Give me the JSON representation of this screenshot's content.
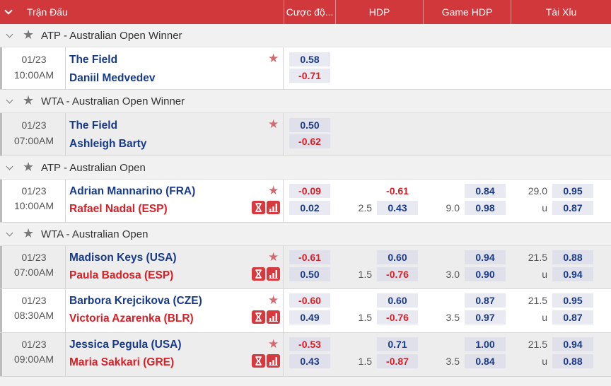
{
  "header": {
    "match_label": "Trận Đấu",
    "odds_label": "Cược độ...",
    "hdp_label": "HDP",
    "game_hdp_label": "Game HDP",
    "taixiu_label": "Tài Xỉu"
  },
  "colors": {
    "header_bg": "#d0383c",
    "team_blue": "#183a8a",
    "team_red": "#d91f26",
    "odds_red": "#d91f26"
  },
  "sections": [
    {
      "league": "ATP - Australian Open Winner",
      "matches": [
        {
          "date": "01/23",
          "time": "10:00AM",
          "home": {
            "name": "The Field",
            "color": "blue"
          },
          "away": {
            "name": "Daniil Medvedev",
            "color": "blue"
          },
          "icons": false,
          "odds": [
            "0.58",
            "-0.71"
          ]
        }
      ]
    },
    {
      "league": "WTA - Australian Open Winner",
      "matches": [
        {
          "date": "01/23",
          "time": "07:00AM",
          "home": {
            "name": "The Field",
            "color": "blue"
          },
          "away": {
            "name": "Ashleigh Barty",
            "color": "blue"
          },
          "icons": false,
          "odds": [
            "0.50",
            "-0.62"
          ]
        }
      ]
    },
    {
      "league": "ATP - Australian Open",
      "matches": [
        {
          "date": "01/23",
          "time": "10:00AM",
          "home": {
            "name": "Adrian Mannarino (FRA)",
            "color": "blue"
          },
          "away": {
            "name": "Rafael Nadal (ESP)",
            "color": "red"
          },
          "icons": true,
          "odds": [
            "-0.09",
            "0.02"
          ],
          "hdp": {
            "line": "2.5",
            "top": "-0.61",
            "bot": "0.43",
            "top_box": false
          },
          "game_hdp": {
            "line": "9.0",
            "top": "0.84",
            "bot": "0.98"
          },
          "taixiu": {
            "line": "29.0",
            "u": "u",
            "top": "0.95",
            "bot": "0.87"
          }
        }
      ]
    },
    {
      "league": "WTA - Australian Open",
      "matches": [
        {
          "date": "01/23",
          "time": "07:00AM",
          "home": {
            "name": "Madison Keys (USA)",
            "color": "blue"
          },
          "away": {
            "name": "Paula Badosa (ESP)",
            "color": "red"
          },
          "icons": true,
          "odds": [
            "-0.61",
            "0.50"
          ],
          "hdp": {
            "line": "1.5",
            "top": "0.60",
            "bot": "-0.76",
            "top_box": true
          },
          "game_hdp": {
            "line": "3.0",
            "top": "0.94",
            "bot": "0.90"
          },
          "taixiu": {
            "line": "21.5",
            "u": "u",
            "top": "0.88",
            "bot": "0.94"
          }
        },
        {
          "date": "01/23",
          "time": "08:30AM",
          "home": {
            "name": "Barbora Krejcikova (CZE)",
            "color": "blue"
          },
          "away": {
            "name": "Victoria Azarenka (BLR)",
            "color": "red"
          },
          "icons": true,
          "odds": [
            "-0.60",
            "0.49"
          ],
          "hdp": {
            "line": "1.5",
            "top": "0.60",
            "bot": "-0.76",
            "top_box": true
          },
          "game_hdp": {
            "line": "3.5",
            "top": "0.87",
            "bot": "0.97"
          },
          "taixiu": {
            "line": "21.5",
            "u": "u",
            "top": "0.95",
            "bot": "0.87"
          }
        },
        {
          "date": "01/23",
          "time": "09:00AM",
          "home": {
            "name": "Jessica Pegula (USA)",
            "color": "blue"
          },
          "away": {
            "name": "Maria Sakkari (GRE)",
            "color": "red"
          },
          "icons": true,
          "odds": [
            "-0.53",
            "0.43"
          ],
          "hdp": {
            "line": "1.5",
            "top": "0.71",
            "bot": "-0.87",
            "top_box": true
          },
          "game_hdp": {
            "line": "3.5",
            "top": "1.00",
            "bot": "0.84"
          },
          "taixiu": {
            "line": "21.5",
            "u": "u",
            "top": "0.94",
            "bot": "0.88"
          }
        }
      ]
    }
  ]
}
